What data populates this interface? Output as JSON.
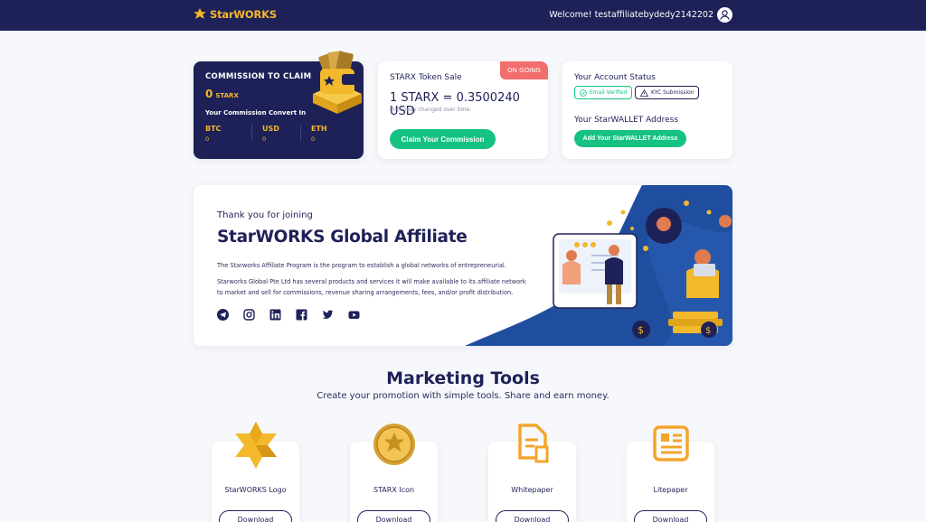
{
  "header": {
    "brand": "StarWORKS",
    "welcome": "Welcome! testaffiliatebydedy2142202",
    "icons": {
      "logo": "star-logo-icon",
      "user": "user-icon"
    }
  },
  "commission": {
    "title": "COMMISSION TO CLAIM",
    "amount": "0",
    "unit": "STARX",
    "convert_label": "Your Commission Convert In",
    "currencies": [
      {
        "label": "BTC",
        "value": "0"
      },
      {
        "label": "USD",
        "value": "0"
      },
      {
        "label": "ETH",
        "value": "0"
      }
    ]
  },
  "token_sale": {
    "badge": "ON GOING",
    "title": "STARX Token Sale",
    "price": "1 STARX = 0.3500240 USD",
    "note": "Price may changed over time.",
    "button": "Claim Your Commission"
  },
  "account_status": {
    "title": "Your Account Status",
    "email_badge": "Email Verified",
    "kyc_badge": "KYC Submission",
    "wallet_title": "Your StarWALLET Address",
    "wallet_button": "Add Your StarWALLET Address"
  },
  "hero": {
    "small": "Thank you for joining",
    "title": "StarWORKS Global Affiliate",
    "p1": "The Starworks Affiliate Program is the program to establish a global networks of entrepreneurial.",
    "p2": "Starworks Global Pte Ltd has several products and services it will make available to its affiliate network to market and sell for commissions, revenue sharing arrangements, fees, and/or profit distribution.",
    "socials": [
      "telegram-icon",
      "instagram-icon",
      "linkedin-icon",
      "facebook-icon",
      "twitter-icon",
      "youtube-icon"
    ]
  },
  "marketing": {
    "title": "Marketing Tools",
    "subtitle": "Create your promotion with simple tools. Share and earn money.",
    "tools": [
      {
        "label": "StarWORKS Logo",
        "button": "Download"
      },
      {
        "label": "STARX Icon",
        "button": "Download"
      },
      {
        "label": "Whitepaper",
        "button": "Download"
      },
      {
        "label": "Litepaper",
        "button": "Download"
      }
    ]
  },
  "colors": {
    "navy": "#1e2157",
    "gold": "#f3b82b",
    "green": "#16c281",
    "badge_red": "#f26d6d",
    "hero_blue": "#1f4e9e"
  }
}
